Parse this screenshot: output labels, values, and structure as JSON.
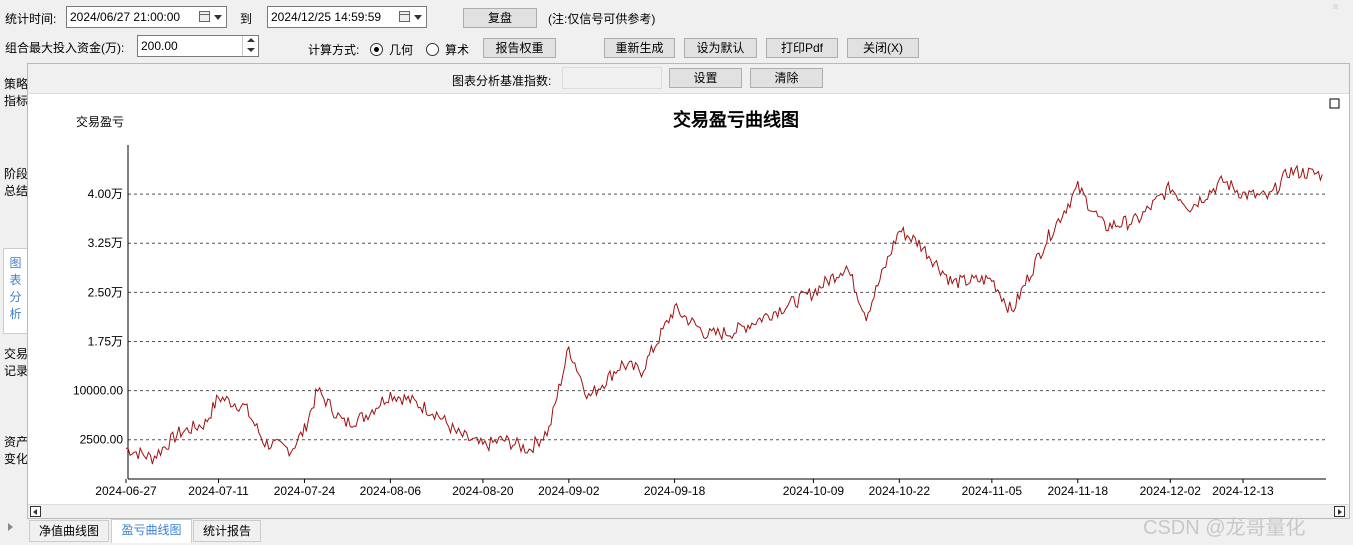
{
  "toolbar": {
    "time_label": "统计时间:",
    "start_date": "2024/06/27 21:00:00",
    "to_label": "到",
    "end_date": "2024/12/25 14:59:59",
    "replay_button": "复盘",
    "note": "(注:仅信号可供参考)",
    "max_fund_label": "组合最大投入资金(万):",
    "max_fund_value": "200.00",
    "calc_method_label": "计算方式:",
    "calc_options": [
      "几何",
      "算术"
    ],
    "calc_selected": "几何",
    "report_weight_button": "报告权重",
    "regenerate_button": "重新生成",
    "set_default_button": "设为默认",
    "print_pdf_button": "打印Pdf",
    "close_button": "关闭(X)"
  },
  "side_tabs": [
    "策略指标",
    "阶段总结",
    "图表分析",
    "交易记录",
    "资产变化"
  ],
  "active_side_tab": "图表分析",
  "chart_toolbar": {
    "baseline_label": "图表分析基准指数:",
    "baseline_value": "",
    "set_button": "设置",
    "clear_button": "清除"
  },
  "bottom_tabs": [
    "净值曲线图",
    "盈亏曲线图",
    "统计报告"
  ],
  "active_bottom_tab": "盈亏曲线图",
  "watermark": "CSDN @龙哥量化",
  "colors": {
    "line": "#a01010",
    "active_tab": "#3c7fcf"
  },
  "chart_data": {
    "type": "line",
    "title": "交易盈亏曲线图",
    "ylabel": "交易盈亏",
    "y_ticks": [
      {
        "value": 2500,
        "label": "2500.00"
      },
      {
        "value": 10000,
        "label": "10000.00"
      },
      {
        "value": 17500,
        "label": "1.75万"
      },
      {
        "value": 25000,
        "label": "2.50万"
      },
      {
        "value": 32500,
        "label": "3.25万"
      },
      {
        "value": 40000,
        "label": "4.00万"
      }
    ],
    "ylim": [
      -3500,
      47500
    ],
    "x_ticks": [
      "2024-06-27",
      "2024-07-11",
      "2024-07-24",
      "2024-08-06",
      "2024-08-20",
      "2024-09-02",
      "2024-09-18",
      "2024-10-09",
      "2024-10-22",
      "2024-11-05",
      "2024-11-18",
      "2024-12-02",
      "2024-12-13"
    ],
    "grid": "horizontal-dashed",
    "series": [
      {
        "name": "",
        "x": [
          "2024-06-27",
          "2024-07-01",
          "2024-07-05",
          "2024-07-09",
          "2024-07-11",
          "2024-07-15",
          "2024-07-18",
          "2024-07-22",
          "2024-07-24",
          "2024-07-26",
          "2024-07-30",
          "2024-08-02",
          "2024-08-06",
          "2024-08-09",
          "2024-08-13",
          "2024-08-16",
          "2024-08-20",
          "2024-08-23",
          "2024-08-27",
          "2024-08-30",
          "2024-09-02",
          "2024-09-05",
          "2024-09-10",
          "2024-09-13",
          "2024-09-18",
          "2024-09-23",
          "2024-09-27",
          "2024-10-09",
          "2024-10-14",
          "2024-10-17",
          "2024-10-22",
          "2024-10-25",
          "2024-10-30",
          "2024-11-05",
          "2024-11-08",
          "2024-11-13",
          "2024-11-18",
          "2024-11-22",
          "2024-11-27",
          "2024-12-02",
          "2024-12-05",
          "2024-12-10",
          "2024-12-13",
          "2024-12-17",
          "2024-12-20",
          "2024-12-25"
        ],
        "values": [
          1200,
          -300,
          3500,
          5000,
          9000,
          7500,
          2000,
          1000,
          4000,
          10000,
          5000,
          6000,
          9500,
          8500,
          6500,
          3500,
          1500,
          2500,
          1000,
          4000,
          16500,
          9000,
          14000,
          13000,
          22500,
          18500,
          19000,
          25000,
          29000,
          21500,
          34500,
          32500,
          26500,
          27000,
          22000,
          32500,
          41000,
          35000,
          36000,
          41000,
          38000,
          42000,
          40000,
          39500,
          43500,
          43000
        ]
      }
    ]
  }
}
